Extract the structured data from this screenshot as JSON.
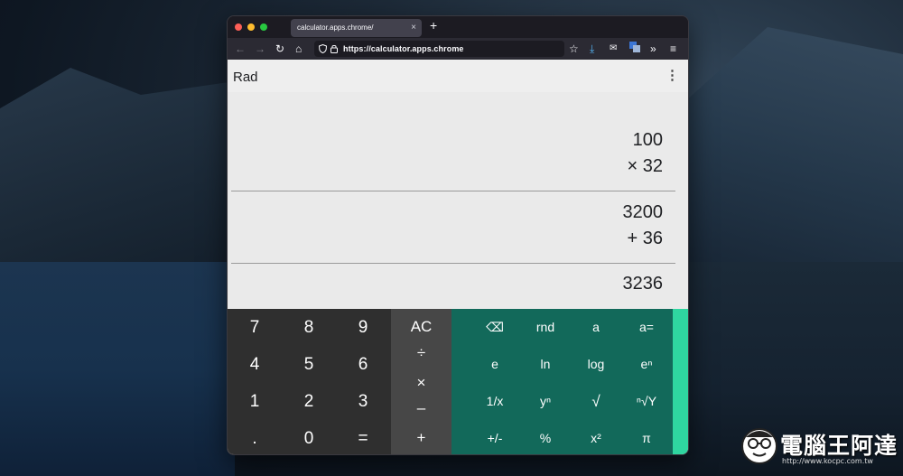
{
  "browser": {
    "tab_title": "calculator.apps.chrome/",
    "tab_close": "×",
    "new_tab": "+",
    "url": "https://calculator.apps.chrome"
  },
  "calculator": {
    "angle_mode": "Rad",
    "menu": "⋮",
    "tape": {
      "line1": "100",
      "line2": "× 32",
      "line3": "3200",
      "line4": "+ 36",
      "result": "3236"
    },
    "digits": [
      "7",
      "8",
      "9",
      "4",
      "5",
      "6",
      "1",
      "2",
      "3",
      ".",
      "0",
      "="
    ],
    "ops": {
      "clear": "AC",
      "divide": "÷",
      "multiply": "×",
      "subtract": "–",
      "add": "+"
    },
    "advanced": [
      "⌫",
      "rnd",
      "a",
      "a=",
      "e",
      "ln",
      "log",
      "eⁿ",
      "1/x",
      "yⁿ",
      "√",
      "ⁿ√Y",
      "+/-",
      "%",
      "x²",
      "π"
    ]
  },
  "watermark": {
    "title": "電腦王阿達",
    "url": "http://www.kocpc.com.tw"
  }
}
